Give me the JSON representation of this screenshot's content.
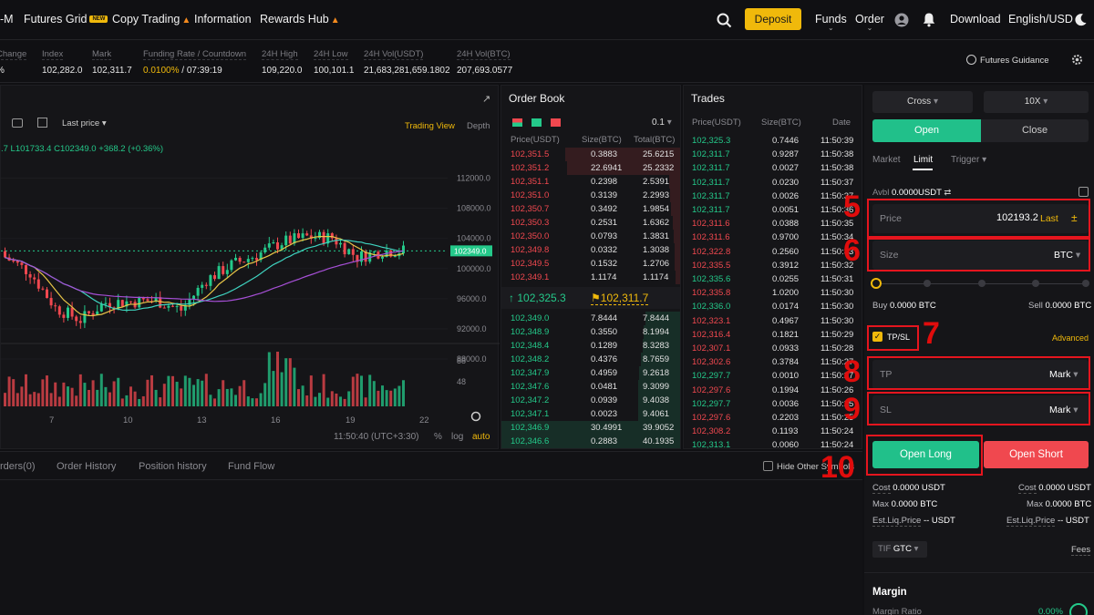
{
  "nav": {
    "items": [
      "-M",
      "Futures Grid",
      "Copy Trading",
      "Information",
      "Rewards Hub"
    ],
    "new_badge": "NEW",
    "deposit": "Deposit",
    "funds": "Funds",
    "order": "Order",
    "download": "Download",
    "lang": "English/USD"
  },
  "ticker": [
    {
      "label": "Change",
      "value": "%",
      "color": "#f0484f"
    },
    {
      "label": "Index",
      "value": "102,282.0",
      "color": "#e6e6e6"
    },
    {
      "label": "Mark",
      "value": "102,311.7",
      "color": "#e6e6e6"
    },
    {
      "label": "Funding Rate / Countdown",
      "value_a": "0.0100%",
      "value_b": " / 07:39:19",
      "color": "#f0b90b"
    },
    {
      "label": "24H High",
      "value": "109,220.0",
      "color": "#e6e6e6"
    },
    {
      "label": "24H Low",
      "value": "100,101.1",
      "color": "#e6e6e6"
    },
    {
      "label": "24H Vol(USDT)",
      "value": "21,683,281,659.1802",
      "color": "#e6e6e6"
    },
    {
      "label": "24H Vol(BTC)",
      "value": "207,693.0577",
      "color": "#e6e6e6"
    }
  ],
  "futures_guidance": "Futures Guidance",
  "chart": {
    "last_price_label": "Last price",
    "trading_view": "Trading View",
    "depth": "Depth",
    "ohlc_a": ".7 L101733.4 C102349.0",
    "ohlc_b": "+368.2 (+0.36%)",
    "price_ticks": [
      "112000.0",
      "108000.0",
      "104000.0",
      "100000.0",
      "96000.0",
      "92000.0",
      "88000.0"
    ],
    "current_price_tag": "102349.0",
    "vol_ticks": [
      "88",
      "48"
    ],
    "date_ticks": [
      "7",
      "10",
      "13",
      "16",
      "19",
      "22"
    ],
    "time": "11:50:40 (UTC+3:30)",
    "pct": "%",
    "log": "log",
    "auto": "auto"
  },
  "chart_data": {
    "type": "candlestick",
    "title": "",
    "x": [
      "6",
      "7",
      "8",
      "9",
      "10",
      "11",
      "12",
      "13",
      "14",
      "15",
      "16",
      "17",
      "18",
      "19",
      "20",
      "21"
    ],
    "close_approx": [
      101500,
      99500,
      94800,
      93200,
      95500,
      95600,
      95800,
      94500,
      98500,
      100500,
      101800,
      103500,
      104200,
      104100,
      101500,
      102349
    ],
    "last_close": 102349.0,
    "ylim": [
      88000,
      114000
    ]
  },
  "orderbook": {
    "title": "Order Book",
    "step": "0.1",
    "headers": [
      "Price(USDT)",
      "Size(BTC)",
      "Total(BTC)"
    ],
    "asks": [
      [
        "102,351.5",
        "0.3883",
        "25.6215"
      ],
      [
        "102,351.2",
        "22.6941",
        "25.2332"
      ],
      [
        "102,351.1",
        "0.2398",
        "2.5391"
      ],
      [
        "102,351.0",
        "0.3139",
        "2.2993"
      ],
      [
        "102,350.7",
        "0.3492",
        "1.9854"
      ],
      [
        "102,350.3",
        "0.2531",
        "1.6362"
      ],
      [
        "102,350.0",
        "0.0793",
        "1.3831"
      ],
      [
        "102,349.8",
        "0.0332",
        "1.3038"
      ],
      [
        "102,349.5",
        "0.1532",
        "1.2706"
      ],
      [
        "102,349.1",
        "1.1174",
        "1.1174"
      ]
    ],
    "mid": "102,325.3",
    "mark": "102,311.7",
    "bids": [
      [
        "102,349.0",
        "7.8444",
        "7.8444"
      ],
      [
        "102,348.9",
        "0.3550",
        "8.1994"
      ],
      [
        "102,348.4",
        "0.1289",
        "8.3283"
      ],
      [
        "102,348.2",
        "0.4376",
        "8.7659"
      ],
      [
        "102,347.9",
        "0.4959",
        "9.2618"
      ],
      [
        "102,347.6",
        "0.0481",
        "9.3099"
      ],
      [
        "102,347.2",
        "0.0939",
        "9.4038"
      ],
      [
        "102,347.1",
        "0.0023",
        "9.4061"
      ],
      [
        "102,346.9",
        "30.4991",
        "39.9052"
      ],
      [
        "102,346.6",
        "0.2883",
        "40.1935"
      ]
    ]
  },
  "trades": {
    "title": "Trades",
    "headers": [
      "Price(USDT)",
      "Size(BTC)",
      "Date"
    ],
    "rows": [
      [
        "102,325.3",
        "0.7446",
        "11:50:39",
        "g"
      ],
      [
        "102,311.7",
        "0.9287",
        "11:50:38",
        "g"
      ],
      [
        "102,311.7",
        "0.0027",
        "11:50:38",
        "g"
      ],
      [
        "102,311.7",
        "0.0230",
        "11:50:37",
        "g"
      ],
      [
        "102,311.7",
        "0.0026",
        "11:50:37",
        "g"
      ],
      [
        "102,311.7",
        "0.0051",
        "11:50:36",
        "g"
      ],
      [
        "102,311.6",
        "0.0388",
        "11:50:35",
        "r"
      ],
      [
        "102,311.6",
        "0.9700",
        "11:50:34",
        "r"
      ],
      [
        "102,322.8",
        "0.2560",
        "11:50:33",
        "r"
      ],
      [
        "102,335.5",
        "0.3912",
        "11:50:32",
        "r"
      ],
      [
        "102,335.6",
        "0.0255",
        "11:50:31",
        "g"
      ],
      [
        "102,335.8",
        "1.0200",
        "11:50:30",
        "r"
      ],
      [
        "102,336.0",
        "0.0174",
        "11:50:30",
        "g"
      ],
      [
        "102,323.1",
        "0.4967",
        "11:50:30",
        "r"
      ],
      [
        "102,316.4",
        "0.1821",
        "11:50:29",
        "r"
      ],
      [
        "102,307.1",
        "0.0933",
        "11:50:28",
        "r"
      ],
      [
        "102,302.6",
        "0.3784",
        "11:50:27",
        "r"
      ],
      [
        "102,297.7",
        "0.0010",
        "11:50:27",
        "g"
      ],
      [
        "102,297.6",
        "0.1994",
        "11:50:26",
        "r"
      ],
      [
        "102,297.7",
        "0.0036",
        "11:50:25",
        "g"
      ],
      [
        "102,297.6",
        "0.2203",
        "11:50:25",
        "r"
      ],
      [
        "102,308.2",
        "0.1193",
        "11:50:24",
        "r"
      ],
      [
        "102,313.1",
        "0.0060",
        "11:50:24",
        "g"
      ]
    ]
  },
  "bottom_tabs": [
    "rders(0)",
    "Order History",
    "Position history",
    "Fund Flow"
  ],
  "hide_other": "Hide Other Symbols",
  "order_panel": {
    "cross": "Cross",
    "leverage": "10X",
    "open": "Open",
    "close": "Close",
    "types": [
      "Market",
      "Limit",
      "Trigger"
    ],
    "avbl_label": "Avbl",
    "avbl_value": "0.0000USDT",
    "price_label": "Price",
    "price_value": "102193.2",
    "last": "Last",
    "size_label": "Size",
    "size_unit": "BTC",
    "buy": "Buy",
    "buy_value": "0.0000 BTC",
    "sell": "Sell",
    "sell_value": "0.0000 BTC",
    "tpsl": "TP/SL",
    "advanced": "Advanced",
    "tp": "TP",
    "sl": "SL",
    "mark": "Mark",
    "open_long": "Open Long",
    "open_short": "Open Short",
    "cost": "Cost",
    "cost_val": "0.0000 USDT",
    "max": "Max",
    "max_val": "0.0000 BTC",
    "liq": "Est.Liq.Price",
    "liq_val": "-- USDT",
    "tif": "TIF",
    "gtc": "GTC",
    "fees": "Fees",
    "margin": "Margin",
    "margin_ratio": "Margin Ratio",
    "margin_ratio_val": "0.00%"
  },
  "annotations": [
    "5",
    "6",
    "7",
    "8",
    "9",
    "10"
  ]
}
